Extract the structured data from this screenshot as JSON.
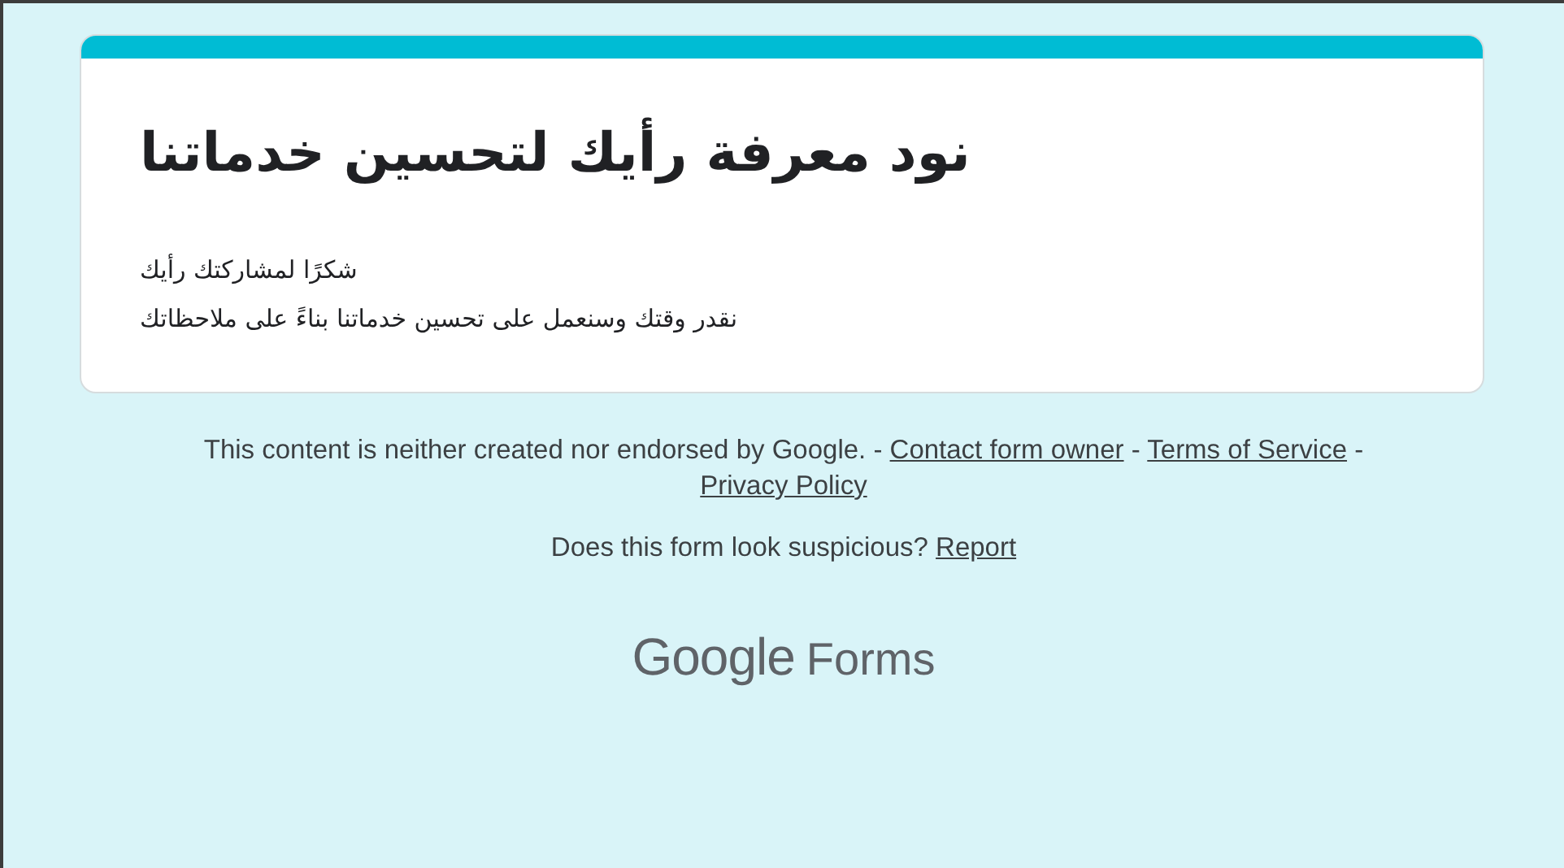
{
  "card": {
    "title": "نود معرفة رأيك لتحسين خدماتنا",
    "lines": [
      "شكرًا لمشاركتك رأيك",
      "نقدر وقتك وسنعمل على تحسين خدماتنا بناءً على ملاحظاتك"
    ]
  },
  "footer": {
    "disclaimer": [
      {
        "kind": "text",
        "text": "This content is neither created nor endorsed by Google. - "
      },
      {
        "kind": "link",
        "text": "Contact form owner"
      },
      {
        "kind": "text",
        "text": " - "
      },
      {
        "kind": "link",
        "text": "Terms of Service"
      },
      {
        "kind": "text",
        "text": " - "
      },
      {
        "kind": "link",
        "text": "Privacy Policy"
      }
    ],
    "question": "Does this form look suspicious?",
    "report": "Report",
    "logo": {
      "brand": "Google",
      "product": "Forms"
    }
  }
}
